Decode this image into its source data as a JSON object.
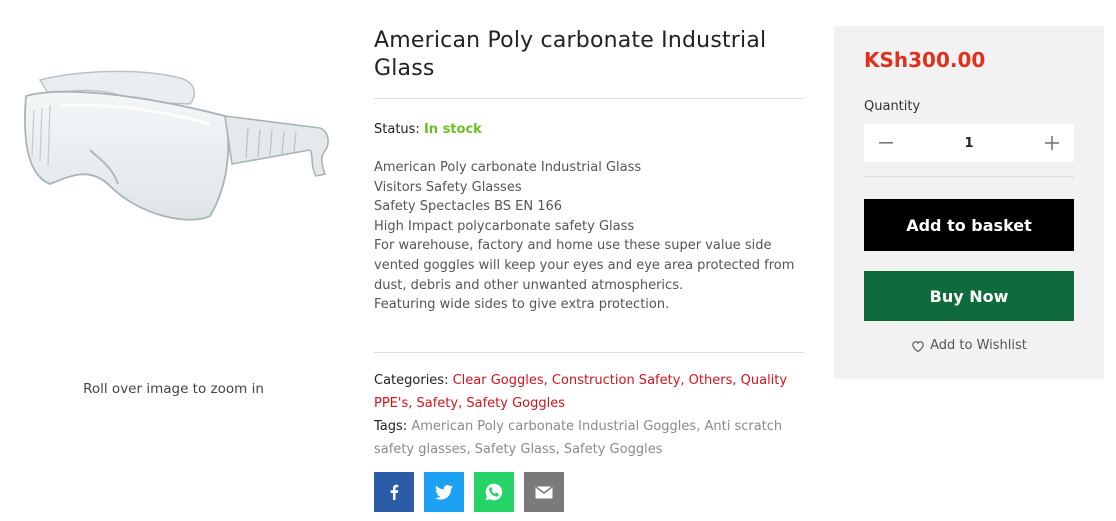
{
  "product": {
    "title": "American Poly carbonate Industrial Glass",
    "zoom_hint": "Roll over image to zoom in",
    "status_label": "Status:",
    "status_value": "In stock",
    "description": [
      "American Poly carbonate Industrial Glass",
      "Visitors Safety Glasses",
      "Safety Spectacles BS EN 166",
      "High Impact polycarbonate safety Glass",
      "For warehouse, factory and home use these super value side vented goggles will keep your eyes and eye area protected from dust, debris and other unwanted atmospherics.",
      "Featuring wide sides to give extra protection."
    ],
    "categories_label": "Categories:",
    "categories": [
      "Clear Goggles",
      "Construction Safety",
      "Others",
      "Quality PPE's",
      "Safety",
      "Safety Goggles"
    ],
    "tags_label": "Tags:",
    "tags": [
      "American Poly carbonate Industrial Goggles",
      "Anti scratch safety glasses",
      "Safety Glass",
      "Safety Goggles"
    ]
  },
  "share": {
    "icons": [
      "facebook-icon",
      "twitter-icon",
      "whatsapp-icon",
      "email-icon"
    ]
  },
  "buybox": {
    "price": "KSh300.00",
    "quantity_label": "Quantity",
    "quantity_value": "1",
    "minus": "−",
    "plus": "+",
    "add_to_basket": "Add to basket",
    "buy_now": "Buy Now",
    "wishlist": "Add to Wishlist"
  },
  "colors": {
    "price": "#e0301e",
    "in_stock": "#6cbf1f",
    "link": "#d0141a",
    "buy_now": "#0f6b3b",
    "add_to_basket": "#000000",
    "buybox_bg": "#f2f2f2"
  }
}
